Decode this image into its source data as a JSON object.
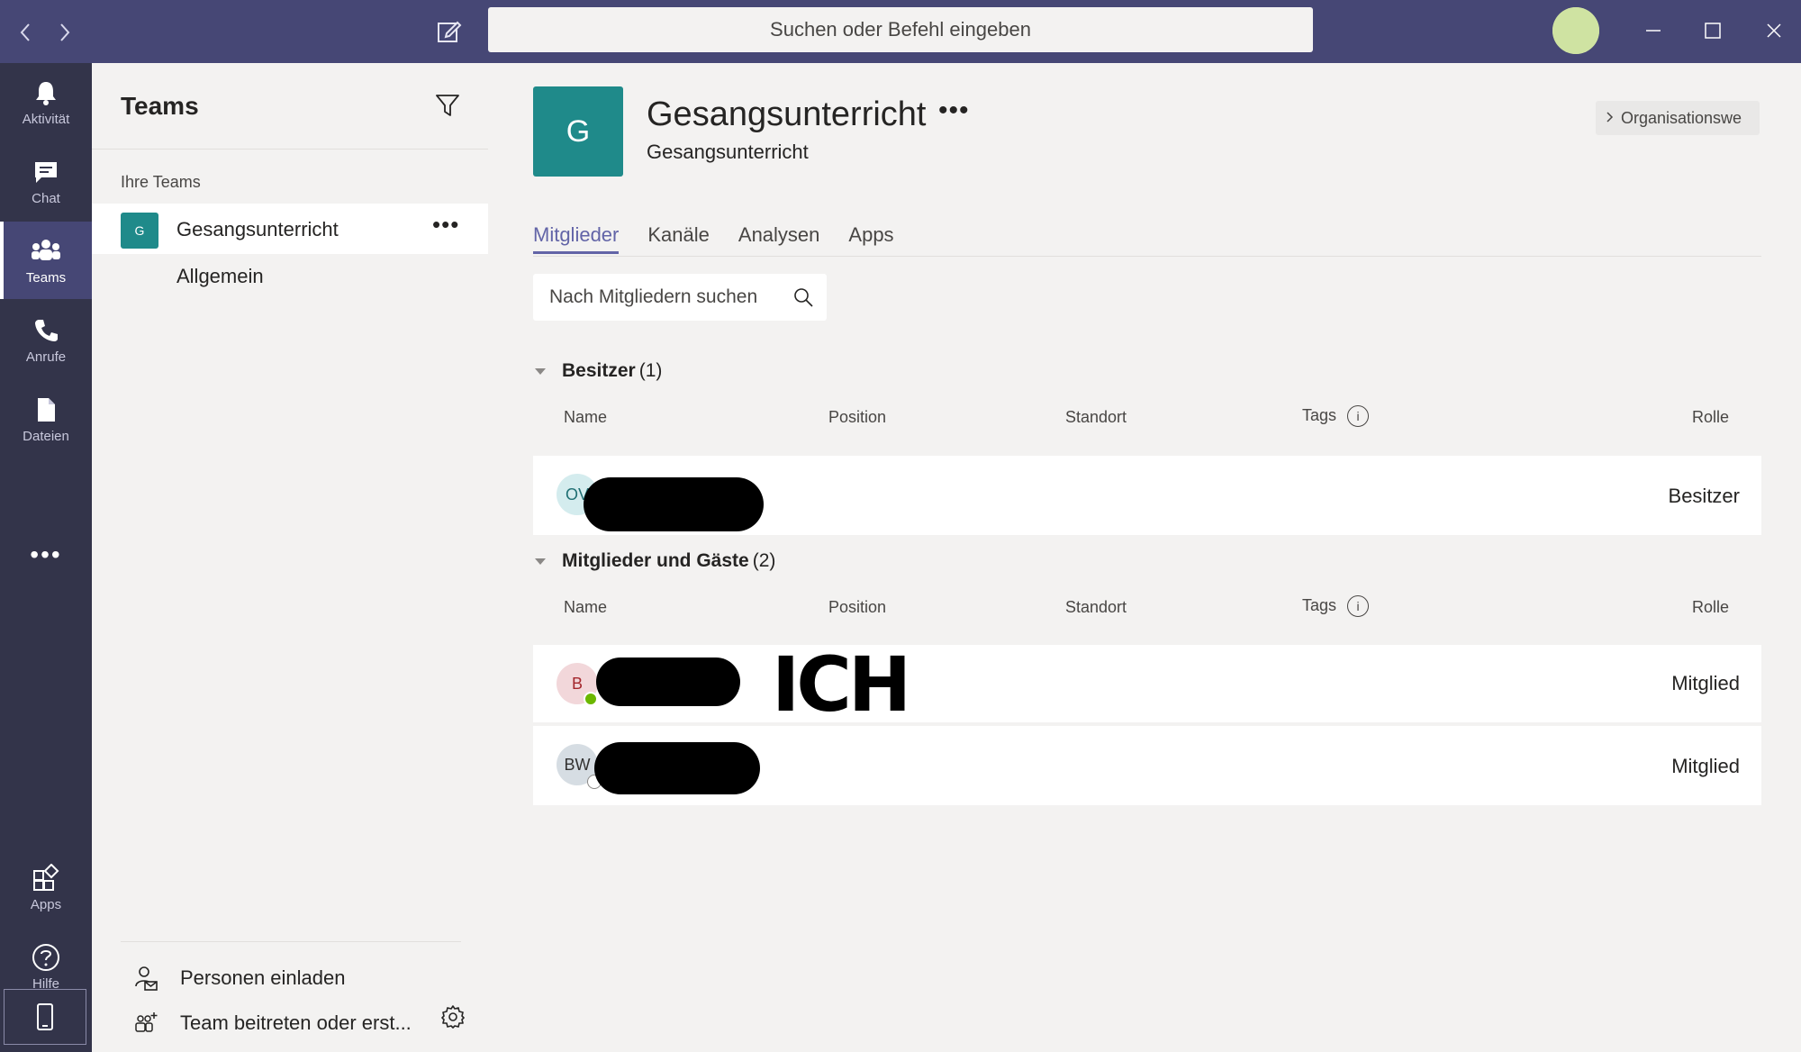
{
  "titlebar": {
    "search_placeholder": "Suchen oder Befehl eingeben",
    "accent": "#464775"
  },
  "rail": {
    "items": [
      {
        "label": "Aktivität",
        "icon": "bell-icon"
      },
      {
        "label": "Chat",
        "icon": "chat-icon"
      },
      {
        "label": "Teams",
        "icon": "teams-icon",
        "active": true
      },
      {
        "label": "Anrufe",
        "icon": "phone-icon"
      },
      {
        "label": "Dateien",
        "icon": "file-icon"
      },
      {
        "label": "Apps",
        "icon": "apps-icon"
      },
      {
        "label": "Hilfe",
        "icon": "help-icon"
      }
    ],
    "more": "•••"
  },
  "panel": {
    "title": "Teams",
    "section_label": "Ihre Teams",
    "team": {
      "initial": "G",
      "name": "Gesangsunterricht",
      "more": "•••"
    },
    "channel": "Allgemein",
    "invite_label": "Personen einladen",
    "join_label": "Team beitreten oder erst..."
  },
  "main": {
    "avatar_initial": "G",
    "title": "Gesangsunterricht",
    "title_more": "•••",
    "subtitle": "Gesangsunterricht",
    "org_button": "Organisationswe",
    "tabs": [
      "Mitglieder",
      "Kanäle",
      "Analysen",
      "Apps"
    ],
    "member_search_placeholder": "Nach Mitgliedern suchen",
    "columns": {
      "name": "Name",
      "position": "Position",
      "standort": "Standort",
      "tags": "Tags",
      "tags_info": "i",
      "rolle": "Rolle"
    },
    "owners": {
      "title": "Besitzer",
      "count": "(1)",
      "members": [
        {
          "initials": "OV",
          "role": "Besitzer"
        }
      ]
    },
    "members": {
      "title": "Mitglieder und Gäste",
      "count": "(2)",
      "members": [
        {
          "initials": "B",
          "role": "Mitglied",
          "annotation": "ICH"
        },
        {
          "initials": "BW",
          "role": "Mitglied"
        }
      ]
    }
  }
}
